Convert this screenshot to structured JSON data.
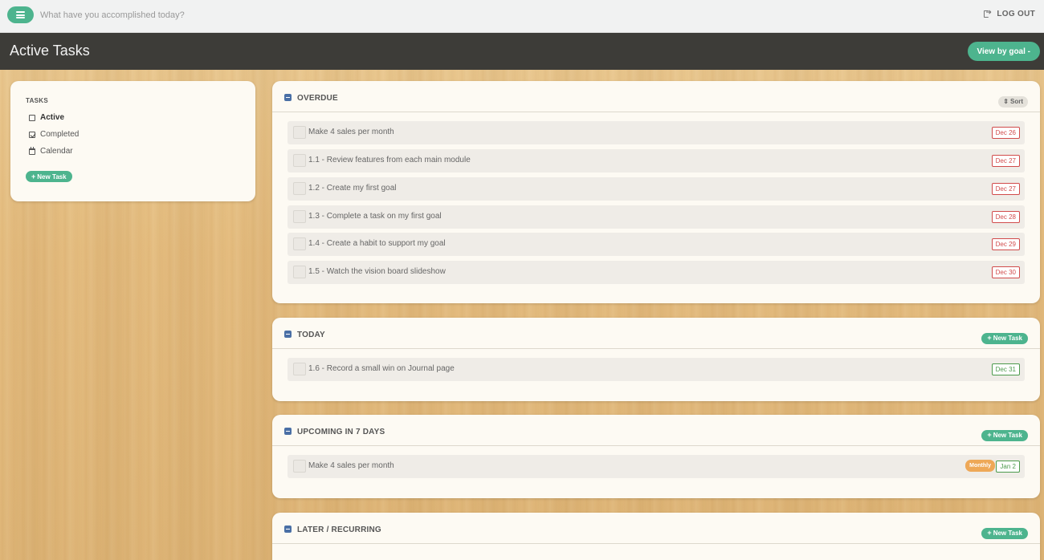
{
  "topbar": {
    "quick_add_placeholder": "What have you accomplished today?",
    "logout_label": "LOG OUT"
  },
  "titlebar": {
    "title": "Active Tasks",
    "view_button": "View by goal -"
  },
  "sidebar": {
    "heading": "TASKS",
    "items": [
      {
        "label": "Active",
        "icon": "square-icon",
        "active": true
      },
      {
        "label": "Completed",
        "icon": "check-square-icon",
        "active": false
      },
      {
        "label": "Calendar",
        "icon": "calendar-icon",
        "active": false
      }
    ],
    "new_task_label": "New Task"
  },
  "sections": {
    "overdue": {
      "title": "OVERDUE",
      "action_label": "Sort",
      "tasks": [
        {
          "text": "Make 4 sales per month",
          "date": "Dec 26"
        },
        {
          "text": "1.1 - Review features from each main module",
          "date": "Dec 27"
        },
        {
          "text": "1.2 - Create my first goal",
          "date": "Dec 27"
        },
        {
          "text": "1.3 - Complete a task on my first goal",
          "date": "Dec 28"
        },
        {
          "text": "1.4 - Create a habit to support my goal",
          "date": "Dec 29"
        },
        {
          "text": "1.5 - Watch the vision board slideshow",
          "date": "Dec 30"
        }
      ]
    },
    "today": {
      "title": "TODAY",
      "action_label": "New Task",
      "tasks": [
        {
          "text": "1.6 - Record a small win on Journal page",
          "date": "Dec 31"
        }
      ]
    },
    "upcoming": {
      "title": "UPCOMING IN 7 DAYS",
      "action_label": "New Task",
      "tasks": [
        {
          "text": "Make 4 sales per month",
          "frequency": "Monthly",
          "date": "Jan 2"
        }
      ]
    },
    "later": {
      "title": "LATER / RECURRING",
      "action_label": "New Task"
    }
  },
  "colors": {
    "accent": "#4db48e",
    "titlebar": "#3d3c38",
    "overdue": "#d14b4b",
    "due": "#4c9a4c",
    "monthly": "#eea857",
    "collapse": "#4a6fa5"
  }
}
